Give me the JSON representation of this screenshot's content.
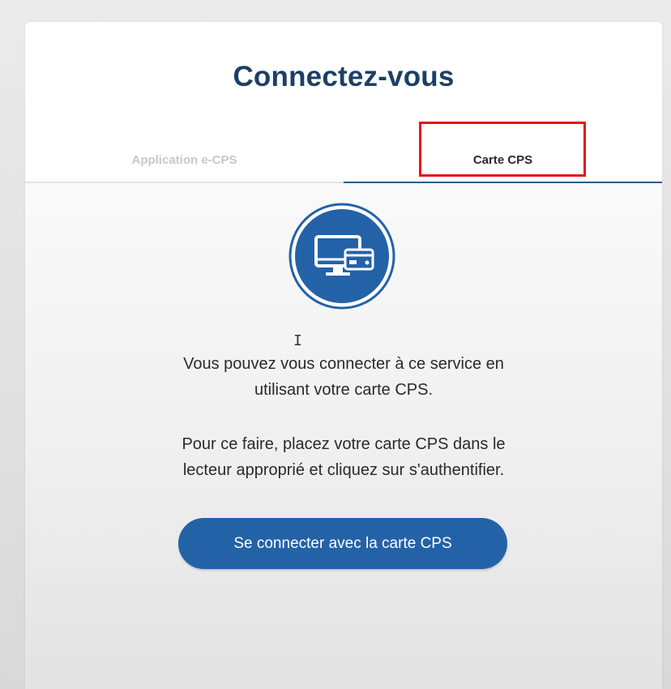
{
  "login": {
    "title": "Connectez-vous",
    "tabs": [
      {
        "label": "Application e-CPS",
        "active": false
      },
      {
        "label": "Carte CPS",
        "active": true
      }
    ],
    "icon": "computer-with-card-icon",
    "paragraph1_line1": "Vous pouvez vous connecter à ce service en",
    "paragraph1_line2": "utilisant votre carte CPS.",
    "paragraph2_line1": "Pour ce faire, placez votre carte CPS dans le",
    "paragraph2_line2": "lecteur approprié et cliquez sur s'authentifier.",
    "button_label": "Se connecter avec la carte CPS"
  },
  "colors": {
    "title": "#1c3f66",
    "accent": "#2462a8",
    "highlight": "#e4151b",
    "inactive_tab": "#c8c8c8"
  }
}
